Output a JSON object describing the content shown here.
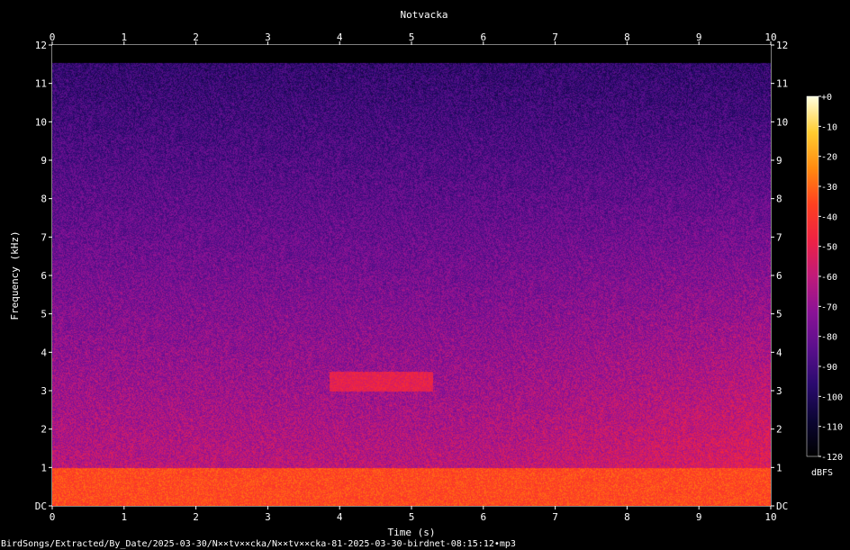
{
  "chart_data": {
    "type": "heatmap",
    "title": "Notvacka",
    "xlabel": "Time (s)",
    "ylabel": "Frequency (kHz)",
    "xlim": [
      0,
      10
    ],
    "ylim": [
      0,
      12
    ],
    "x_ticks": [
      "0",
      "1",
      "2",
      "3",
      "4",
      "5",
      "6",
      "7",
      "8",
      "9",
      "10"
    ],
    "y_ticks": [
      "DC",
      "1",
      "2",
      "3",
      "4",
      "5",
      "6",
      "7",
      "8",
      "9",
      "10",
      "11",
      "12"
    ],
    "colorbar": {
      "label": "dBFS",
      "range": [
        -120,
        0
      ],
      "ticks": [
        "+0",
        "-10",
        "-20",
        "-30",
        "-40",
        "-50",
        "-60",
        "-70",
        "-80",
        "-90",
        "-100",
        "-110",
        "-120"
      ]
    },
    "features": [
      {
        "t_start": 3.85,
        "t_end": 5.3,
        "f_low": 3.0,
        "f_high": 3.5,
        "level_dbfs": -50
      },
      {
        "t_start": 0.0,
        "t_end": 10.0,
        "f_low": 0.0,
        "f_high": 1.0,
        "level_dbfs": -35
      }
    ],
    "colors": [
      "#000000",
      "#0b0533",
      "#2a0a6e",
      "#5a0f8c",
      "#8a1296",
      "#c01a7a",
      "#ee2244",
      "#ff4020",
      "#ff8a10",
      "#ffcc30",
      "#ffffe0"
    ]
  },
  "footer": {
    "filename": "BirdSongs/Extracted/By_Date/2025-03-30/N××tv××cka/N××tv××cka-81-2025-03-30-birdnet-08:15:12•mp3"
  }
}
